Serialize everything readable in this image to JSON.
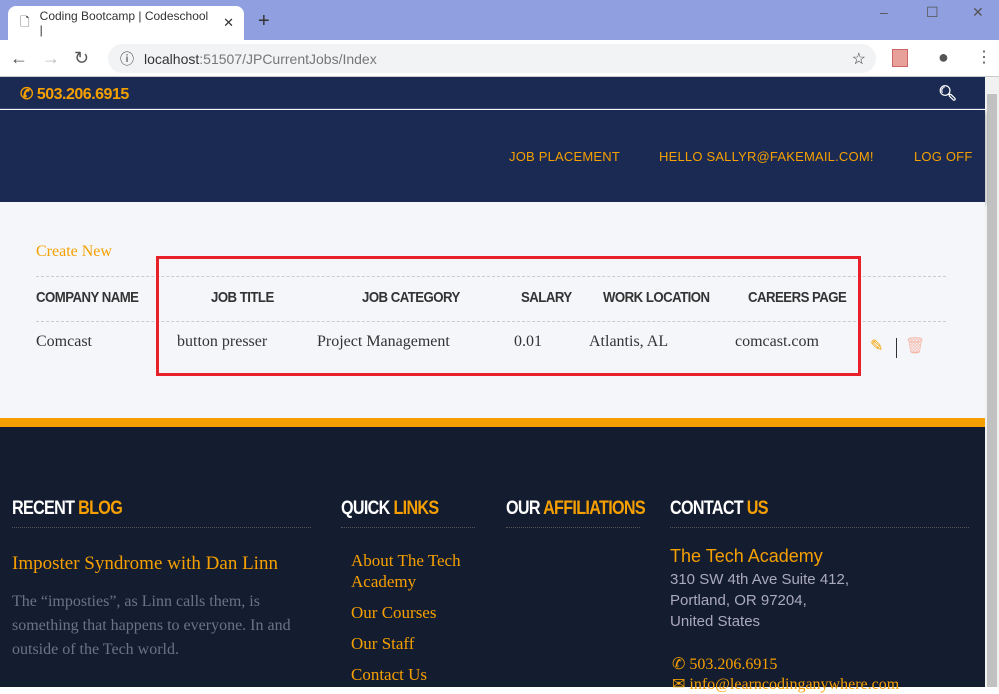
{
  "browser": {
    "tab_title": "Coding Bootcamp | Codeschool |",
    "url_host": "localhost",
    "url_path": ":51507/JPCurrentJobs/Index"
  },
  "topbar": {
    "phone": "503.206.6915"
  },
  "nav": {
    "items": [
      "JOB PLACEMENT",
      "HELLO SALLYR@FAKEMAIL.COM!",
      "LOG OFF"
    ]
  },
  "main": {
    "create_new": "Create New",
    "columns": [
      "COMPANY NAME",
      "JOB TITLE",
      "JOB CATEGORY",
      "SALARY",
      "WORK LOCATION",
      "CAREERS PAGE"
    ],
    "rows": [
      [
        "Comcast",
        "button presser",
        "Project Management",
        "0.01",
        "Atlantis, AL",
        "comcast.com"
      ]
    ]
  },
  "footer": {
    "blog": {
      "h1": "RECENT",
      "h2": "BLOG",
      "title": "Imposter Syndrome with Dan Linn",
      "excerpt": "The “imposties”, as Linn calls them, is something that happens to everyone. In and outside of the Tech world."
    },
    "links": {
      "h1": "QUICK",
      "h2": "LINKS",
      "items": [
        "About The Tech Academy",
        "Our Courses",
        "Our Staff",
        "Contact Us"
      ]
    },
    "affiliations": {
      "h1": "OUR",
      "h2": "AFFILIATIONS"
    },
    "contact": {
      "h1": "CONTACT",
      "h2": "US",
      "name": "The Tech Academy",
      "address": [
        "310 SW 4th Ave Suite 412,",
        "Portland, OR 97204,",
        "United States"
      ],
      "phone": "503.206.6915",
      "email": "info@learncodinganywhere.com"
    }
  },
  "colors": {
    "accent": "#f5a000",
    "navy": "#1b2a52",
    "footer": "#141c30",
    "highlight": "#e8202a"
  }
}
